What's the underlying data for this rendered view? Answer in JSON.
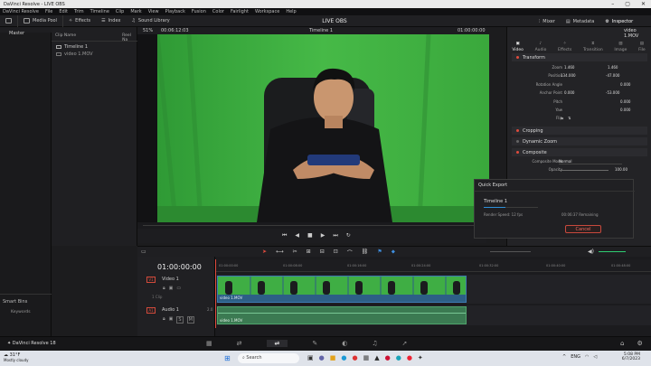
{
  "window": {
    "title": "DaVinci Resolve - LIVE OBS"
  },
  "menu": [
    "DaVinci Resolve",
    "File",
    "Edit",
    "Trim",
    "Timeline",
    "Clip",
    "Mark",
    "View",
    "Playback",
    "Fusion",
    "Color",
    "Fairlight",
    "Workspace",
    "Help"
  ],
  "toolbar": {
    "media_pool": "Media Pool",
    "effects": "Effects",
    "index": "Index",
    "sound_library": "Sound Library",
    "project_name": "LIVE OBS",
    "mixer": "Mixer",
    "metadata": "Metadata",
    "inspector": "Inspector"
  },
  "left_panel": {
    "master": "Master",
    "smart_bins": "Smart Bins",
    "keywords": "Keywords"
  },
  "clip_panel": {
    "header_name": "Clip Name",
    "header_reel": "Reel Na",
    "items": [
      "Timeline 1",
      "video 1.MOV"
    ]
  },
  "viewer": {
    "zoom": "51%",
    "timecode": "00:06:12:03",
    "timeline_name": "Timeline 1",
    "duration_tc": "01:00:00:00"
  },
  "inspector": {
    "clip_title": "video 1.MOV",
    "tabs": [
      "Video",
      "Audio",
      "Effects",
      "Transition",
      "Image",
      "File"
    ],
    "transform": {
      "title": "Transform",
      "zoom_label": "Zoom",
      "zoom_x": "1.460",
      "zoom_y": "1.460",
      "position_label": "Position",
      "pos_x": "134.000",
      "pos_y": "-47.000",
      "rotation_label": "Rotation Angle",
      "rotation": "0.000",
      "anchor_label": "Anchor Point",
      "anchor_x": "0.000",
      "anchor_y": "-53.000",
      "pitch_label": "Pitch",
      "pitch": "0.000",
      "yaw_label": "Yaw",
      "yaw": "0.000",
      "flip_label": "Flip"
    },
    "cropping": "Cropping",
    "dynamic_zoom": "Dynamic Zoom",
    "composite": {
      "title": "Composite",
      "mode_label": "Composite Mode",
      "mode": "Normal",
      "opacity_label": "Opacity",
      "opacity": "100.00"
    }
  },
  "quick_export": {
    "title": "Quick Export",
    "job": "Timeline 1",
    "progress": 0.4,
    "speed": "Render Speed: 12 fps",
    "remaining": "00:06:37 Remaining",
    "cancel": "Cancel"
  },
  "timeline": {
    "timecode": "01:00:00:00",
    "ruler": [
      "01:00:00:00",
      "01:00:08:00",
      "01:00:16:00",
      "01:00:24:00",
      "01:00:32:00",
      "01:00:40:00",
      "01:00:48:00"
    ],
    "video_track": "Video 1",
    "video_id": "V1",
    "clip_count": "1 Clip",
    "audio_track": "Audio 1",
    "audio_id": "A1",
    "audio_ch": "2.0",
    "video_clip": "video 1.MOV",
    "audio_clip": "video 1.MOV"
  },
  "pagenav": {
    "app": "DaVinci Resolve 18"
  },
  "taskbar": {
    "temp": "31°F",
    "weather": "Mostly cloudy",
    "search": "Search",
    "lang": "ENG",
    "time": "5:08 PM",
    "date": "6/7/2023"
  }
}
